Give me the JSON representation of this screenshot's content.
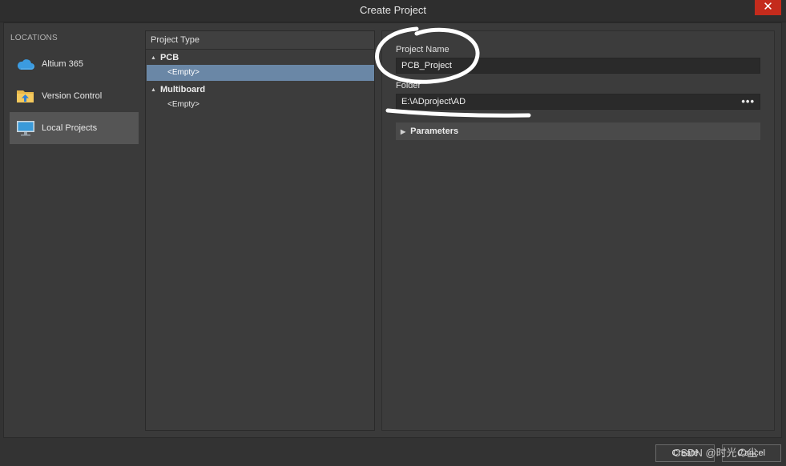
{
  "window": {
    "title": "Create Project",
    "close_glyph": "✕"
  },
  "locations": {
    "header": "LOCATIONS",
    "items": [
      {
        "label": "Altium 365",
        "icon": "cloud-icon",
        "selected": false
      },
      {
        "label": "Version Control",
        "icon": "folder-upload-icon",
        "selected": false
      },
      {
        "label": "Local Projects",
        "icon": "monitor-icon",
        "selected": true
      }
    ]
  },
  "project_type": {
    "header": "Project Type",
    "groups": [
      {
        "label": "PCB",
        "items": [
          {
            "label": "<Empty>",
            "selected": true
          }
        ]
      },
      {
        "label": "Multiboard",
        "items": [
          {
            "label": "<Empty>",
            "selected": false
          }
        ]
      }
    ]
  },
  "form": {
    "project_name_label": "Project Name",
    "project_name_value": "PCB_Project",
    "folder_label": "Folder",
    "folder_value": "E:\\ADproject\\AD",
    "browse_label": "•••",
    "parameters_label": "Parameters"
  },
  "buttons": {
    "create": "Create",
    "cancel": "Cancel"
  },
  "watermark": "CSDN @时光の尘",
  "colors": {
    "selection": "#6a87a6",
    "annotation": "#ffffff",
    "close": "#c42b1c"
  }
}
